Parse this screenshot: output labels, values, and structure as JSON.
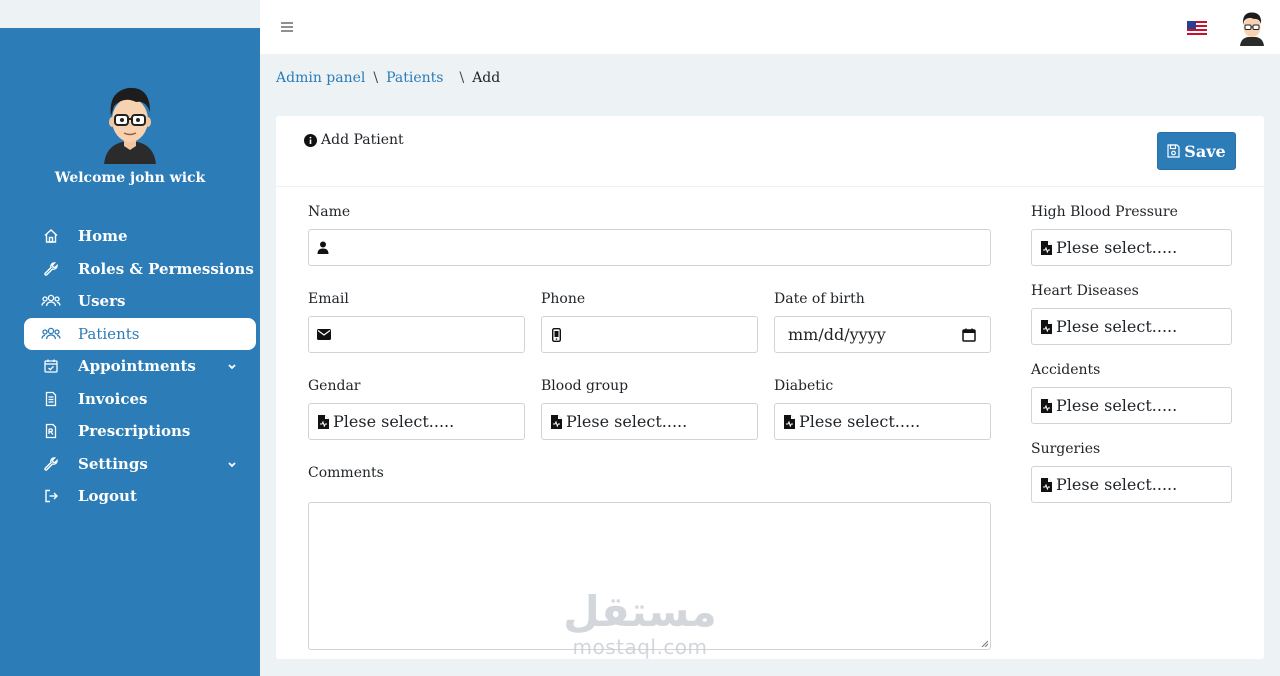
{
  "sidebar": {
    "welcome": "Welcome john wick",
    "items": [
      {
        "label": "Home",
        "icon": "home-icon"
      },
      {
        "label": "Roles & Permessions",
        "icon": "wrench-icon"
      },
      {
        "label": "Users",
        "icon": "users-icon"
      },
      {
        "label": "Patients",
        "icon": "patients-icon",
        "active": true
      },
      {
        "label": "Appointments",
        "icon": "calendar-icon",
        "expandable": true
      },
      {
        "label": "Invoices",
        "icon": "invoice-icon"
      },
      {
        "label": "Prescriptions",
        "icon": "prescription-icon"
      },
      {
        "label": "Settings",
        "icon": "settings-wrench-icon",
        "expandable": true
      },
      {
        "label": "Logout",
        "icon": "logout-icon"
      }
    ]
  },
  "breadcrumb": {
    "root": "Admin panel",
    "section": "Patients",
    "separator": "\\",
    "current": "Add"
  },
  "card": {
    "title": "Add Patient",
    "save_label": "Save"
  },
  "form": {
    "name_label": "Name",
    "email_label": "Email",
    "phone_label": "Phone",
    "dob_label": "Date of birth",
    "dob_placeholder": "mm/dd/yyyy",
    "gender_label": "Gendar",
    "blood_group_label": "Blood group",
    "diabetic_label": "Diabetic",
    "comments_label": "Comments",
    "high_bp_label": "High Blood Pressure",
    "heart_label": "Heart Diseases",
    "accidents_label": "Accidents",
    "surgeries_label": "Surgeries",
    "select_placeholder": "Plese select....."
  },
  "watermark": {
    "arabic": "مستقل",
    "latin": "mostaql.com"
  },
  "colors": {
    "primary": "#2c7cb8",
    "background": "#edf2f5",
    "border": "#ced4da"
  }
}
